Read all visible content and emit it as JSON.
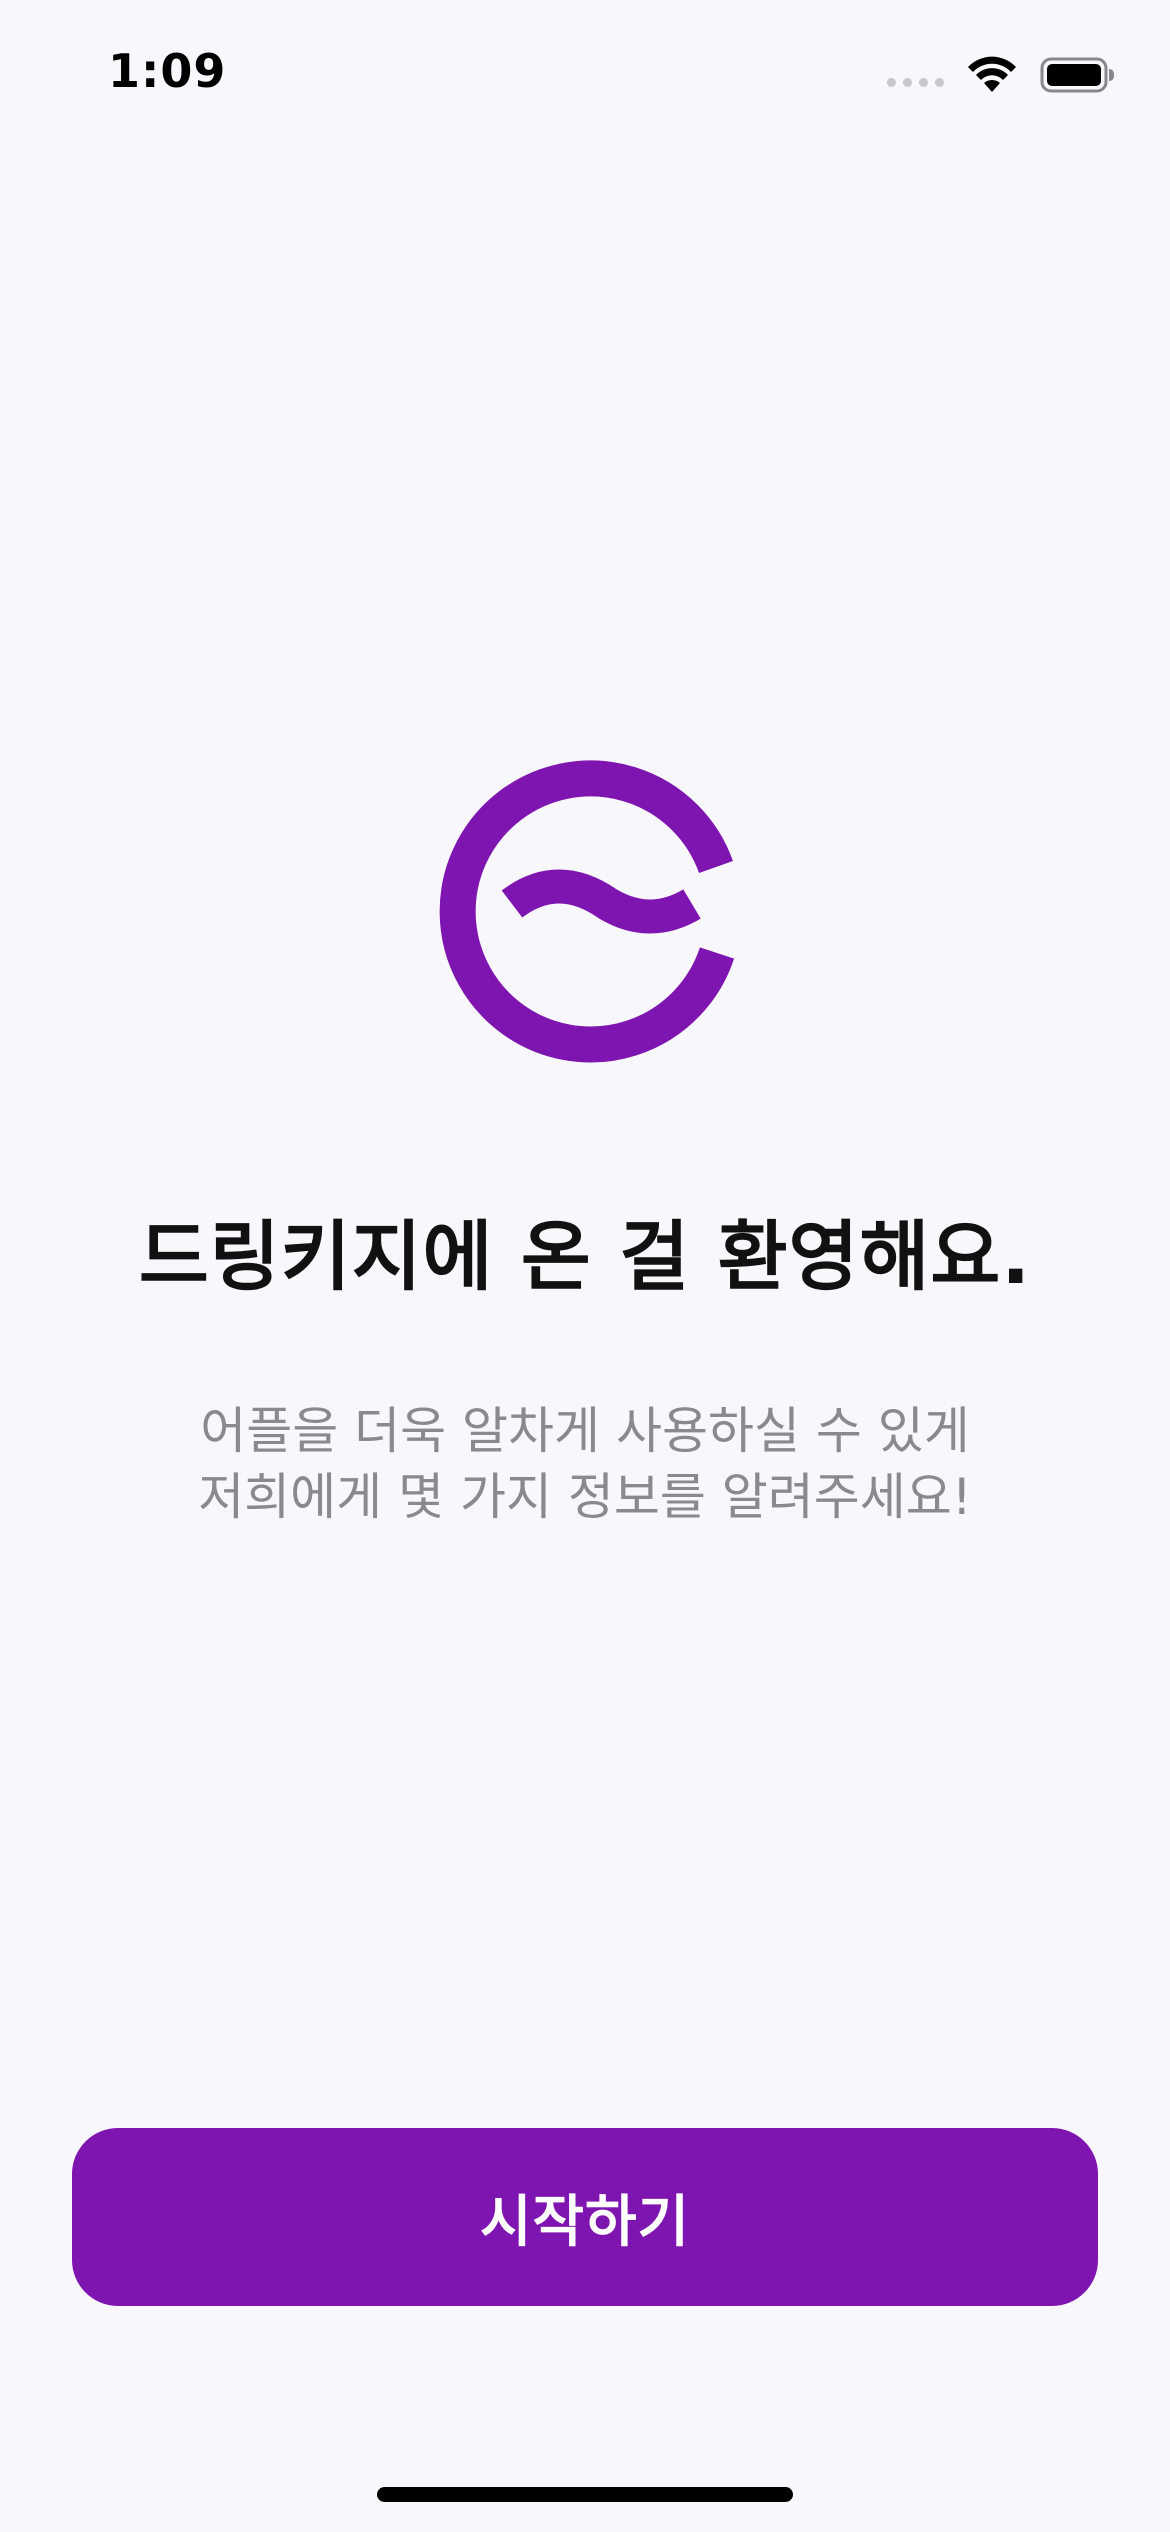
{
  "status_bar": {
    "time": "1:09"
  },
  "logo": {
    "icon": "drinkey-logo-icon",
    "color": "#7f15b1"
  },
  "welcome": {
    "title": "드링키지에 온 걸 환영해요.",
    "subtitle_lines": [
      "어플을 더욱 알차게 사용하실 수 있게",
      "저희에게 몇 가지 정보를 알려주세요!"
    ]
  },
  "start_button": {
    "label": "시작하기",
    "color": "#7f15b1"
  }
}
